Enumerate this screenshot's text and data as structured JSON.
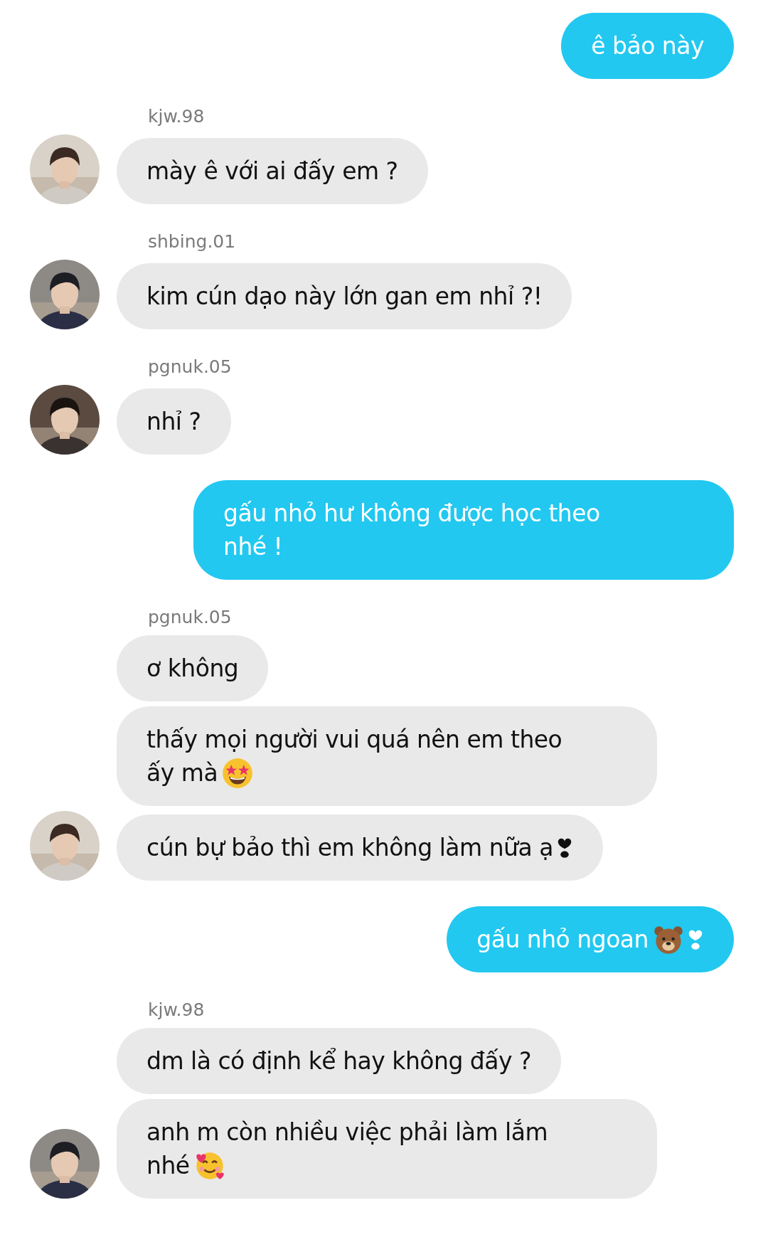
{
  "messages": [
    {
      "kind": "sent",
      "lines": [
        "ê bảo này"
      ]
    },
    {
      "kind": "received",
      "sender": "kjw.98",
      "bubbles": [
        {
          "lines": [
            "mày ê với ai đấy em ?"
          ]
        }
      ]
    },
    {
      "kind": "received",
      "sender": "shbing.01",
      "bubbles": [
        {
          "lines": [
            "kim cún dạo này lớn gan em nhỉ ?!"
          ]
        }
      ]
    },
    {
      "kind": "received",
      "sender": "pgnuk.05",
      "bubbles": [
        {
          "lines": [
            "nhỉ ?"
          ]
        }
      ]
    },
    {
      "kind": "sent",
      "lines": [
        "gấu nhỏ hư không được học theo",
        "nhé !"
      ]
    },
    {
      "kind": "received",
      "sender": "pgnuk.05",
      "bubbles": [
        {
          "lines": [
            "ơ không"
          ]
        },
        {
          "lines": [
            "thấy mọi người vui quá nên em theo",
            "ấy mà"
          ],
          "icons": [
            {
              "kind": "star_eyes"
            }
          ]
        },
        {
          "lines": [
            "cún bự bảo thì em không làm nữa ạ"
          ],
          "icons": [
            {
              "kind": "heart"
            }
          ]
        }
      ]
    },
    {
      "kind": "sent",
      "lines": [
        "gấu nhỏ ngoan"
      ],
      "icons": [
        {
          "kind": "bear"
        },
        {
          "kind": "heart"
        }
      ]
    },
    {
      "kind": "received",
      "sender": "kjw.98",
      "bubbles": [
        {
          "lines": [
            "dm là có định kể hay không đấy ?"
          ]
        },
        {
          "lines": [
            "anh m còn nhiều việc phải làm lắm",
            "nhé"
          ],
          "icons": [
            {
              "kind": "hearts_face"
            }
          ]
        }
      ]
    }
  ]
}
